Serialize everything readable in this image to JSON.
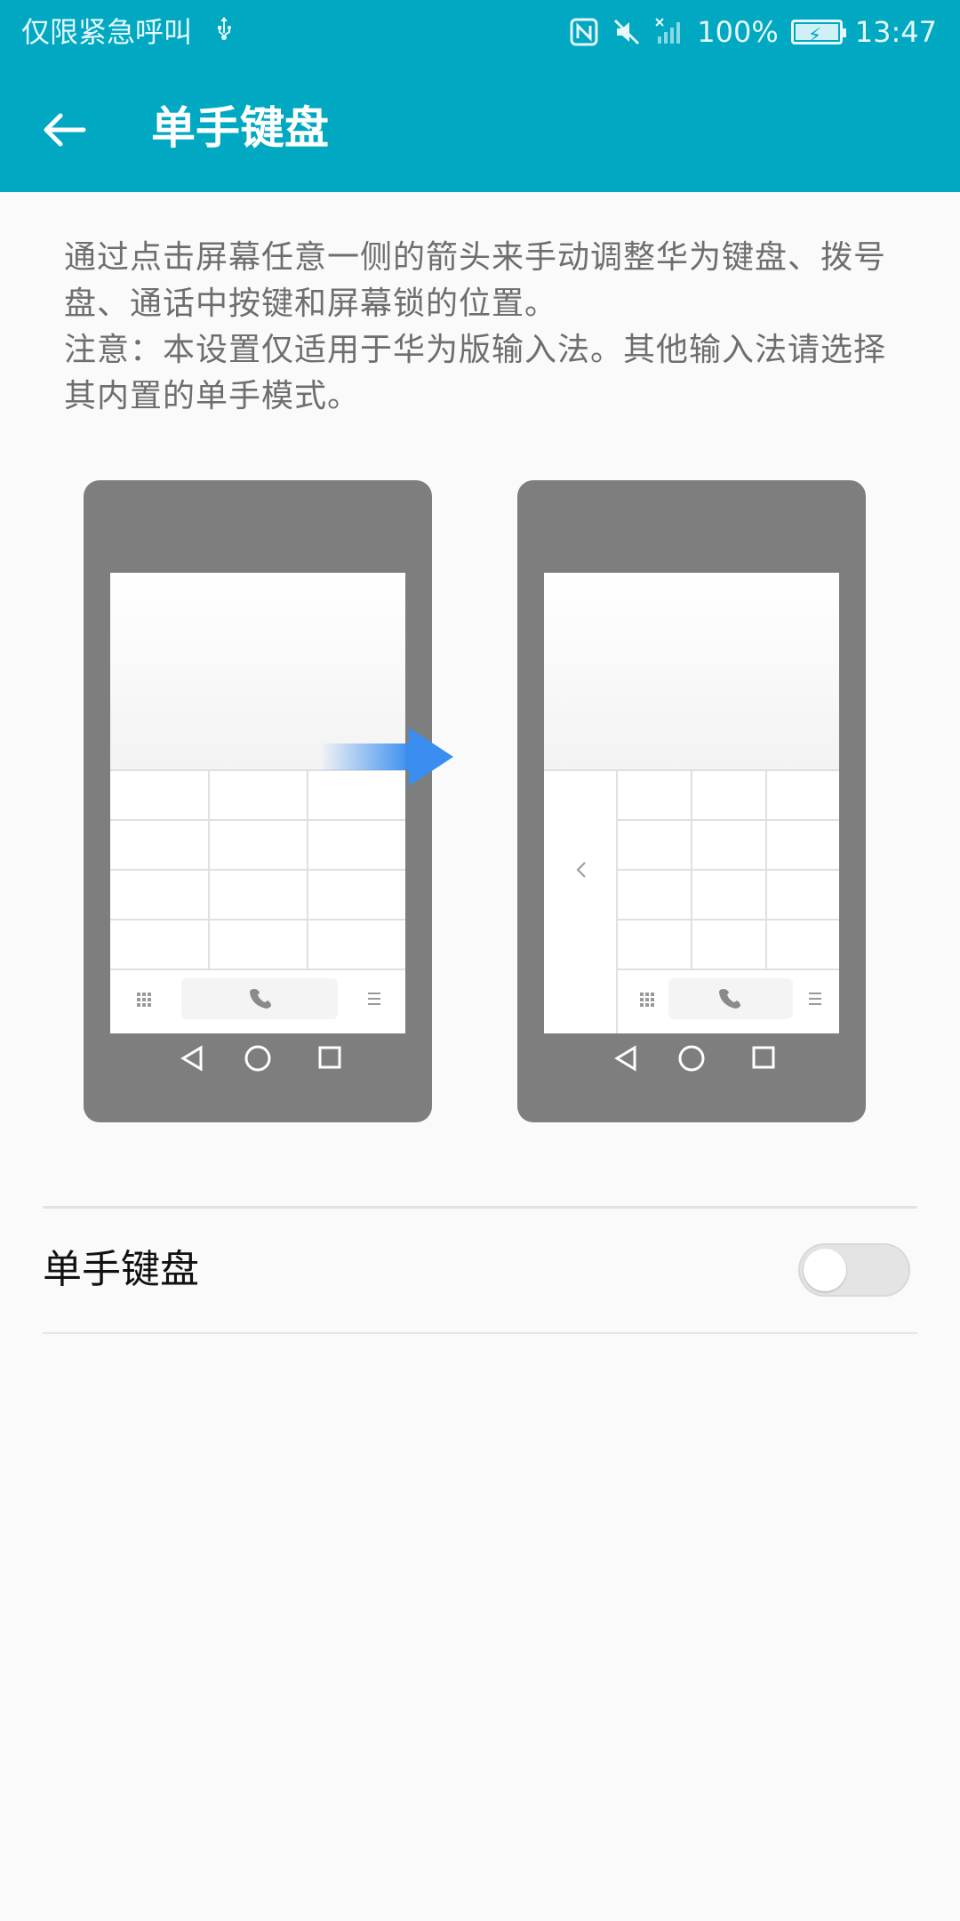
{
  "status_bar": {
    "left_text": "仅限紧急呼叫",
    "usb_icon": "usb-icon",
    "icons": [
      "nfc-icon",
      "mute-icon",
      "signal-icon",
      "battery-icon"
    ],
    "battery_percent": "100%",
    "time": "13:47"
  },
  "title_bar": {
    "back_icon": "arrow-left-icon",
    "title": "单手键盘"
  },
  "description": {
    "line1": "通过点击屏幕任意一侧的箭头来手动调整华为键盘、拨号盘、通话中按键和屏幕锁的位置。",
    "line2": "注意：本设置仅适用于华为版输入法。其他输入法请选择其内置的单手模式。"
  },
  "illustration": {
    "left_phone": "phone-keypad-full",
    "arrow": "arrow-right-icon",
    "right_phone": "phone-keypad-right-aligned",
    "small_left_chevron": "<"
  },
  "settings": {
    "one_hand_label": "单手键盘",
    "toggle_on": false
  },
  "colors": {
    "accent": "#00a9c1",
    "background": "#fafafa",
    "arrow": "#3a8ef0"
  }
}
